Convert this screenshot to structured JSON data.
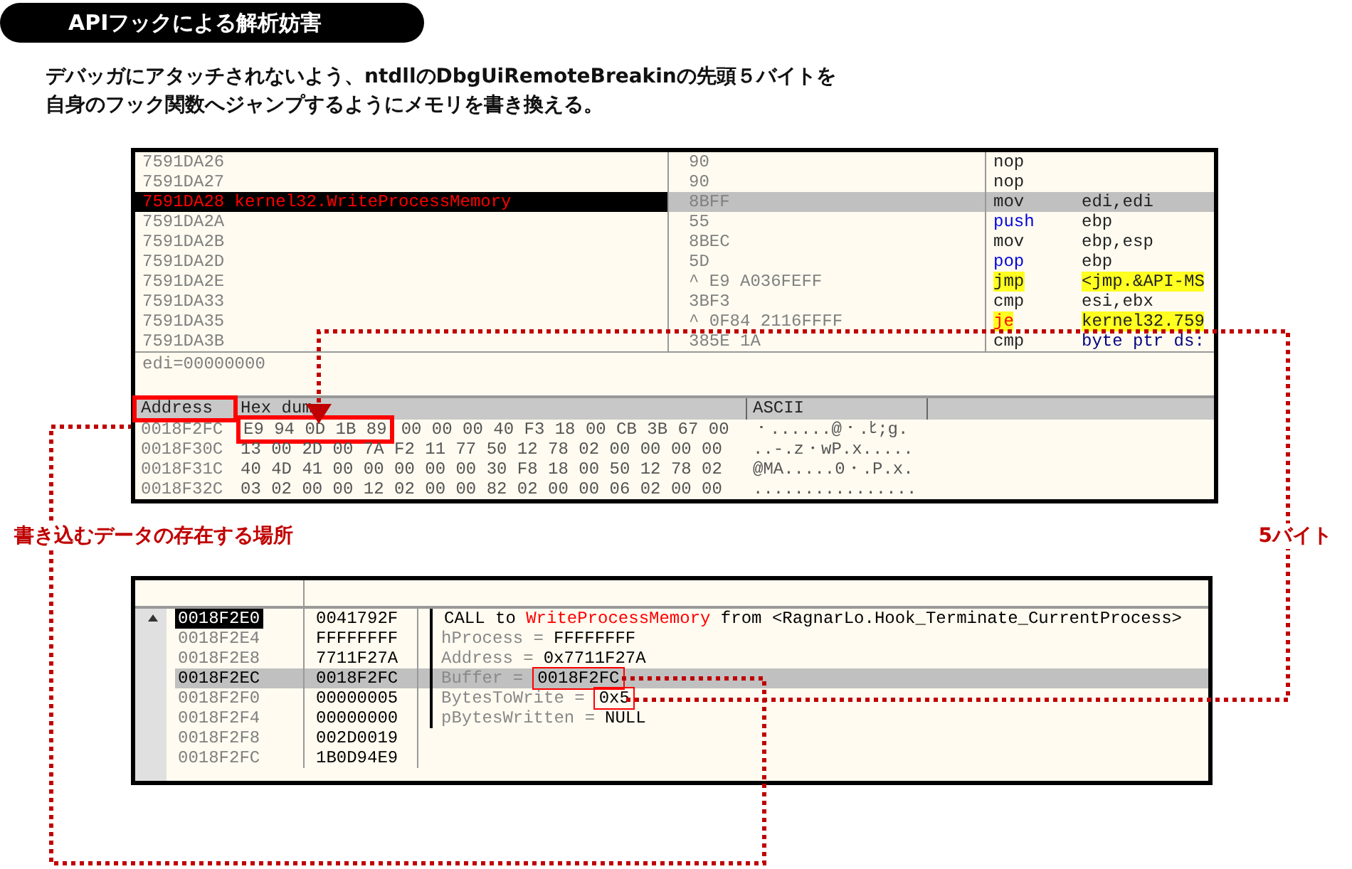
{
  "title": "APIフックによる解析妨害",
  "description": [
    "デバッガにアタッチされないよう、ntdllのDbgUiRemoteBreakinの先頭５バイトを",
    "自身のフック関数へジャンプするようにメモリを書き換える。"
  ],
  "disassembly": {
    "rows": [
      {
        "address": "7591DA26",
        "hex": "90",
        "mnemonic": "nop",
        "operands": "",
        "kind": "plain",
        "selected": false
      },
      {
        "address": "7591DA27",
        "hex": "90",
        "mnemonic": "nop",
        "operands": "",
        "kind": "plain",
        "selected": false
      },
      {
        "address": "7591DA28",
        "label": "kernel32.WriteProcessMemory",
        "hex": "8BFF",
        "mnemonic": "mov",
        "operands": "edi,edi",
        "kind": "plain",
        "selected": true
      },
      {
        "address": "7591DA2A",
        "hex": "55",
        "mnemonic": "push",
        "operands": "ebp",
        "kind": "stack",
        "selected": false
      },
      {
        "address": "7591DA2B",
        "hex": "8BEC",
        "mnemonic": "mov",
        "operands": "ebp,esp",
        "kind": "plain",
        "selected": false
      },
      {
        "address": "7591DA2D",
        "hex": "5D",
        "mnemonic": "pop",
        "operands": "ebp",
        "kind": "stack",
        "selected": false
      },
      {
        "address": "7591DA2E",
        "hex": "^ E9 A036FEFF",
        "mnemonic": "jmp",
        "operands": "<jmp.&API-MS",
        "kind": "jump",
        "selected": false
      },
      {
        "address": "7591DA33",
        "hex": "3BF3",
        "mnemonic": "cmp",
        "operands": "esi,ebx",
        "kind": "plain",
        "selected": false
      },
      {
        "address": "7591DA35",
        "hex": "^ 0F84 2116FFFF",
        "mnemonic": "je",
        "operands": "kernel32.759",
        "kind": "cond_jump",
        "selected": false
      },
      {
        "address": "7591DA3B",
        "hex": "385E 1A",
        "mnemonic": "cmp",
        "operands": "byte ptr ds:",
        "kind": "memory",
        "selected": false
      }
    ]
  },
  "info_line": "edi=00000000",
  "dump": {
    "columns": [
      {
        "label": "Address",
        "marked": true
      },
      {
        "label": "Hex dum",
        "marked": false
      },
      {
        "label": "ASCII",
        "marked": false
      }
    ],
    "rows": [
      {
        "address": "0018F2FC",
        "hex_marked": "E9 94 0D 1B 89",
        "hex": "00 00 00 40 F3 18 00 CB 3B 67 00",
        "ascii": "・......@・.ﾋ;g."
      },
      {
        "address": "0018F30C",
        "hex": "13 00 2D 00 7A F2 11 77 50 12 78 02 00 00 00 00",
        "ascii": "..-.z・wP.x....."
      },
      {
        "address": "0018F31C",
        "hex": "40 4D 41 00 00 00 00 00 30 F8 18 00 50 12 78 02",
        "ascii": "@MA.....0・.P.x."
      },
      {
        "address": "0018F32C",
        "hex": "03 02 00 00 12 02 00 00 82 02 00 00 06 02 00 00",
        "ascii": "................"
      }
    ]
  },
  "annotations": [
    {
      "text": "書き込むデータの存在する場所"
    },
    {
      "text": "5バイト"
    }
  ],
  "stack": {
    "rows": [
      {
        "address": "0018F2E0",
        "value": "0041792F",
        "current": true,
        "selected": false,
        "comment": {
          "kind": "call",
          "prefix": "CALL to ",
          "target": "WriteProcessMemory",
          "suffix": " from <RagnarLo.Hook_Terminate_CurrentProcess>"
        }
      },
      {
        "address": "0018F2E4",
        "value": "FFFFFFFF",
        "current": false,
        "selected": false,
        "comment": {
          "kind": "param",
          "name": "hProcess =",
          "value": "FFFFFFFF",
          "marked": false
        }
      },
      {
        "address": "0018F2E8",
        "value": "7711F27A",
        "current": false,
        "selected": false,
        "comment": {
          "kind": "param",
          "name": "Address =",
          "value": "0x7711F27A",
          "marked": false
        }
      },
      {
        "address": "0018F2EC",
        "value": "0018F2FC",
        "current": false,
        "selected": true,
        "comment": {
          "kind": "param",
          "name": "Buffer =",
          "value": "0018F2FC",
          "marked": true
        }
      },
      {
        "address": "0018F2F0",
        "value": "00000005",
        "current": false,
        "selected": false,
        "comment": {
          "kind": "param",
          "name": "BytesToWrite =",
          "value": "0x5",
          "marked": true
        }
      },
      {
        "address": "0018F2F4",
        "value": "00000000",
        "current": false,
        "selected": false,
        "comment": {
          "kind": "param",
          "name": "pBytesWritten =",
          "value": "NULL",
          "marked": false
        }
      },
      {
        "address": "0018F2F8",
        "value": "002D0019",
        "current": false,
        "selected": false
      },
      {
        "address": "0018F2FC",
        "value": "1B0D94E9",
        "current": false,
        "selected": false
      }
    ]
  }
}
